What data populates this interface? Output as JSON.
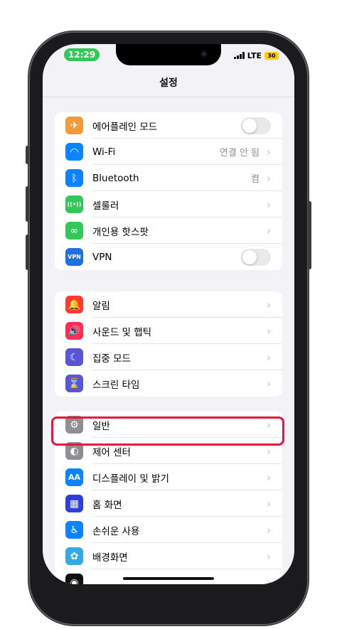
{
  "status_bar": {
    "time": "12:29",
    "network": "LTE",
    "battery": "30"
  },
  "nav": {
    "title": "설정"
  },
  "colors": {
    "time_pill": "#34c759",
    "highlight_border": "#e8163d",
    "battery": "#ffcc00"
  },
  "groups": [
    {
      "items": [
        {
          "name": "airplane-mode",
          "icon": "airplane-icon",
          "icon_glyph": "✈",
          "icon_color": "#f19a37",
          "label": "에어플레인 모드",
          "value": "",
          "control": "toggle"
        },
        {
          "name": "wifi",
          "icon": "wifi-icon",
          "icon_glyph": "◠",
          "icon_color": "#0a84ff",
          "label": "Wi-Fi",
          "value": "연결 안 됨",
          "control": "chevron"
        },
        {
          "name": "bluetooth",
          "icon": "bluetooth-icon",
          "icon_glyph": "ᛒ",
          "icon_color": "#0a84ff",
          "label": "Bluetooth",
          "value": "켬",
          "control": "chevron"
        },
        {
          "name": "cellular",
          "icon": "cellular-icon",
          "icon_glyph": "((•))",
          "icon_color": "#34c759",
          "label": "셀룰러",
          "value": "",
          "control": "chevron"
        },
        {
          "name": "personal-hotspot",
          "icon": "hotspot-icon",
          "icon_glyph": "∞",
          "icon_color": "#34c759",
          "label": "개인용 핫스팟",
          "value": "",
          "control": "chevron"
        },
        {
          "name": "vpn",
          "icon": "vpn-icon",
          "icon_glyph": "VPN",
          "icon_color": "#1f6fe5",
          "label": "VPN",
          "value": "",
          "control": "toggle"
        }
      ]
    },
    {
      "items": [
        {
          "name": "notifications",
          "icon": "bell-icon",
          "icon_glyph": "🔔",
          "icon_color": "#ff3b30",
          "label": "알림",
          "value": "",
          "control": "chevron"
        },
        {
          "name": "sounds-haptics",
          "icon": "speaker-icon",
          "icon_glyph": "🔊",
          "icon_color": "#ff2d55",
          "label": "사운드 및 햅틱",
          "value": "",
          "control": "chevron"
        },
        {
          "name": "focus",
          "icon": "moon-icon",
          "icon_glyph": "☾",
          "icon_color": "#5856d6",
          "label": "집중 모드",
          "value": "",
          "control": "chevron"
        },
        {
          "name": "screen-time",
          "icon": "hourglass-icon",
          "icon_glyph": "⌛",
          "icon_color": "#5856d6",
          "label": "스크린 타임",
          "value": "",
          "control": "chevron"
        }
      ]
    },
    {
      "items": [
        {
          "name": "general",
          "icon": "gear-icon",
          "icon_glyph": "⚙",
          "icon_color": "#8e8e93",
          "label": "일반",
          "value": "",
          "control": "chevron"
        },
        {
          "name": "control-center",
          "icon": "toggles-icon",
          "icon_glyph": "◐",
          "icon_color": "#8e8e93",
          "label": "제어 센터",
          "value": "",
          "control": "chevron"
        },
        {
          "name": "display-brightness",
          "icon": "text-size-icon",
          "icon_glyph": "AA",
          "icon_color": "#0a84ff",
          "label": "디스플레이 및 밝기",
          "value": "",
          "control": "chevron"
        },
        {
          "name": "home-screen",
          "icon": "grid-icon",
          "icon_glyph": "▦",
          "icon_color": "#2f3fd6",
          "label": "홈 화면",
          "value": "",
          "control": "chevron"
        },
        {
          "name": "accessibility",
          "icon": "accessibility-icon",
          "icon_glyph": "♿",
          "icon_color": "#0a84ff",
          "label": "손쉬운 사용",
          "value": "",
          "control": "chevron"
        },
        {
          "name": "wallpaper",
          "icon": "flower-icon",
          "icon_glyph": "✿",
          "icon_color": "#36a9e1",
          "label": "배경화면",
          "value": "",
          "control": "chevron"
        },
        {
          "name": "siri-search",
          "icon": "siri-icon",
          "icon_glyph": "◉",
          "icon_color": "#111111",
          "label": "",
          "value": "",
          "control": "chevron"
        }
      ]
    }
  ]
}
